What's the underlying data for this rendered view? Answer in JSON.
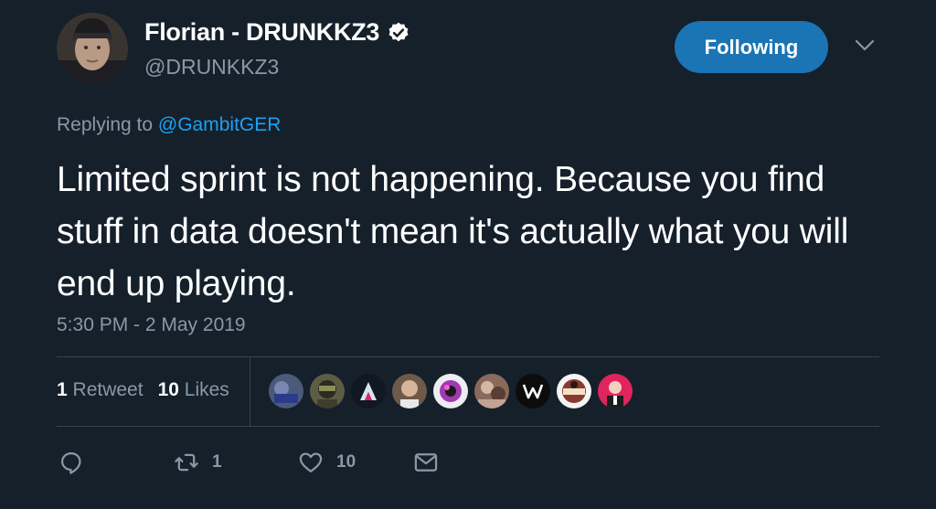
{
  "tweet": {
    "author": {
      "display_name": "Florian - DRUNKKZ3",
      "handle": "@DRUNKKZ3",
      "avatar_icon": "avatar",
      "verified_icon": "verified-badge-icon"
    },
    "follow_button": {
      "label": "Following",
      "color": "#1b74b4"
    },
    "menu_icon": "chevron-down-icon",
    "replying": {
      "prefix": "Replying to",
      "target": "@GambitGER"
    },
    "text": "Limited sprint is not happening. Because you find stuff in data doesn't mean it's actually what you will end up playing.",
    "timestamp": "5:30 PM - 2 May 2019",
    "stats": {
      "retweets_count": "1",
      "retweets_label": "Retweet",
      "likes_count": "10",
      "likes_label": "Likes"
    },
    "likers_count": 9,
    "actions": {
      "reply_icon": "reply-icon",
      "retweet_icon": "retweet-icon",
      "retweet_count": "1",
      "like_icon": "heart-icon",
      "like_count": "10",
      "message_icon": "envelope-icon"
    }
  },
  "colors": {
    "background": "#15202b",
    "text_primary": "#ffffff",
    "text_secondary": "#8899a6",
    "link": "#1da1f2",
    "divider": "#38444d"
  }
}
